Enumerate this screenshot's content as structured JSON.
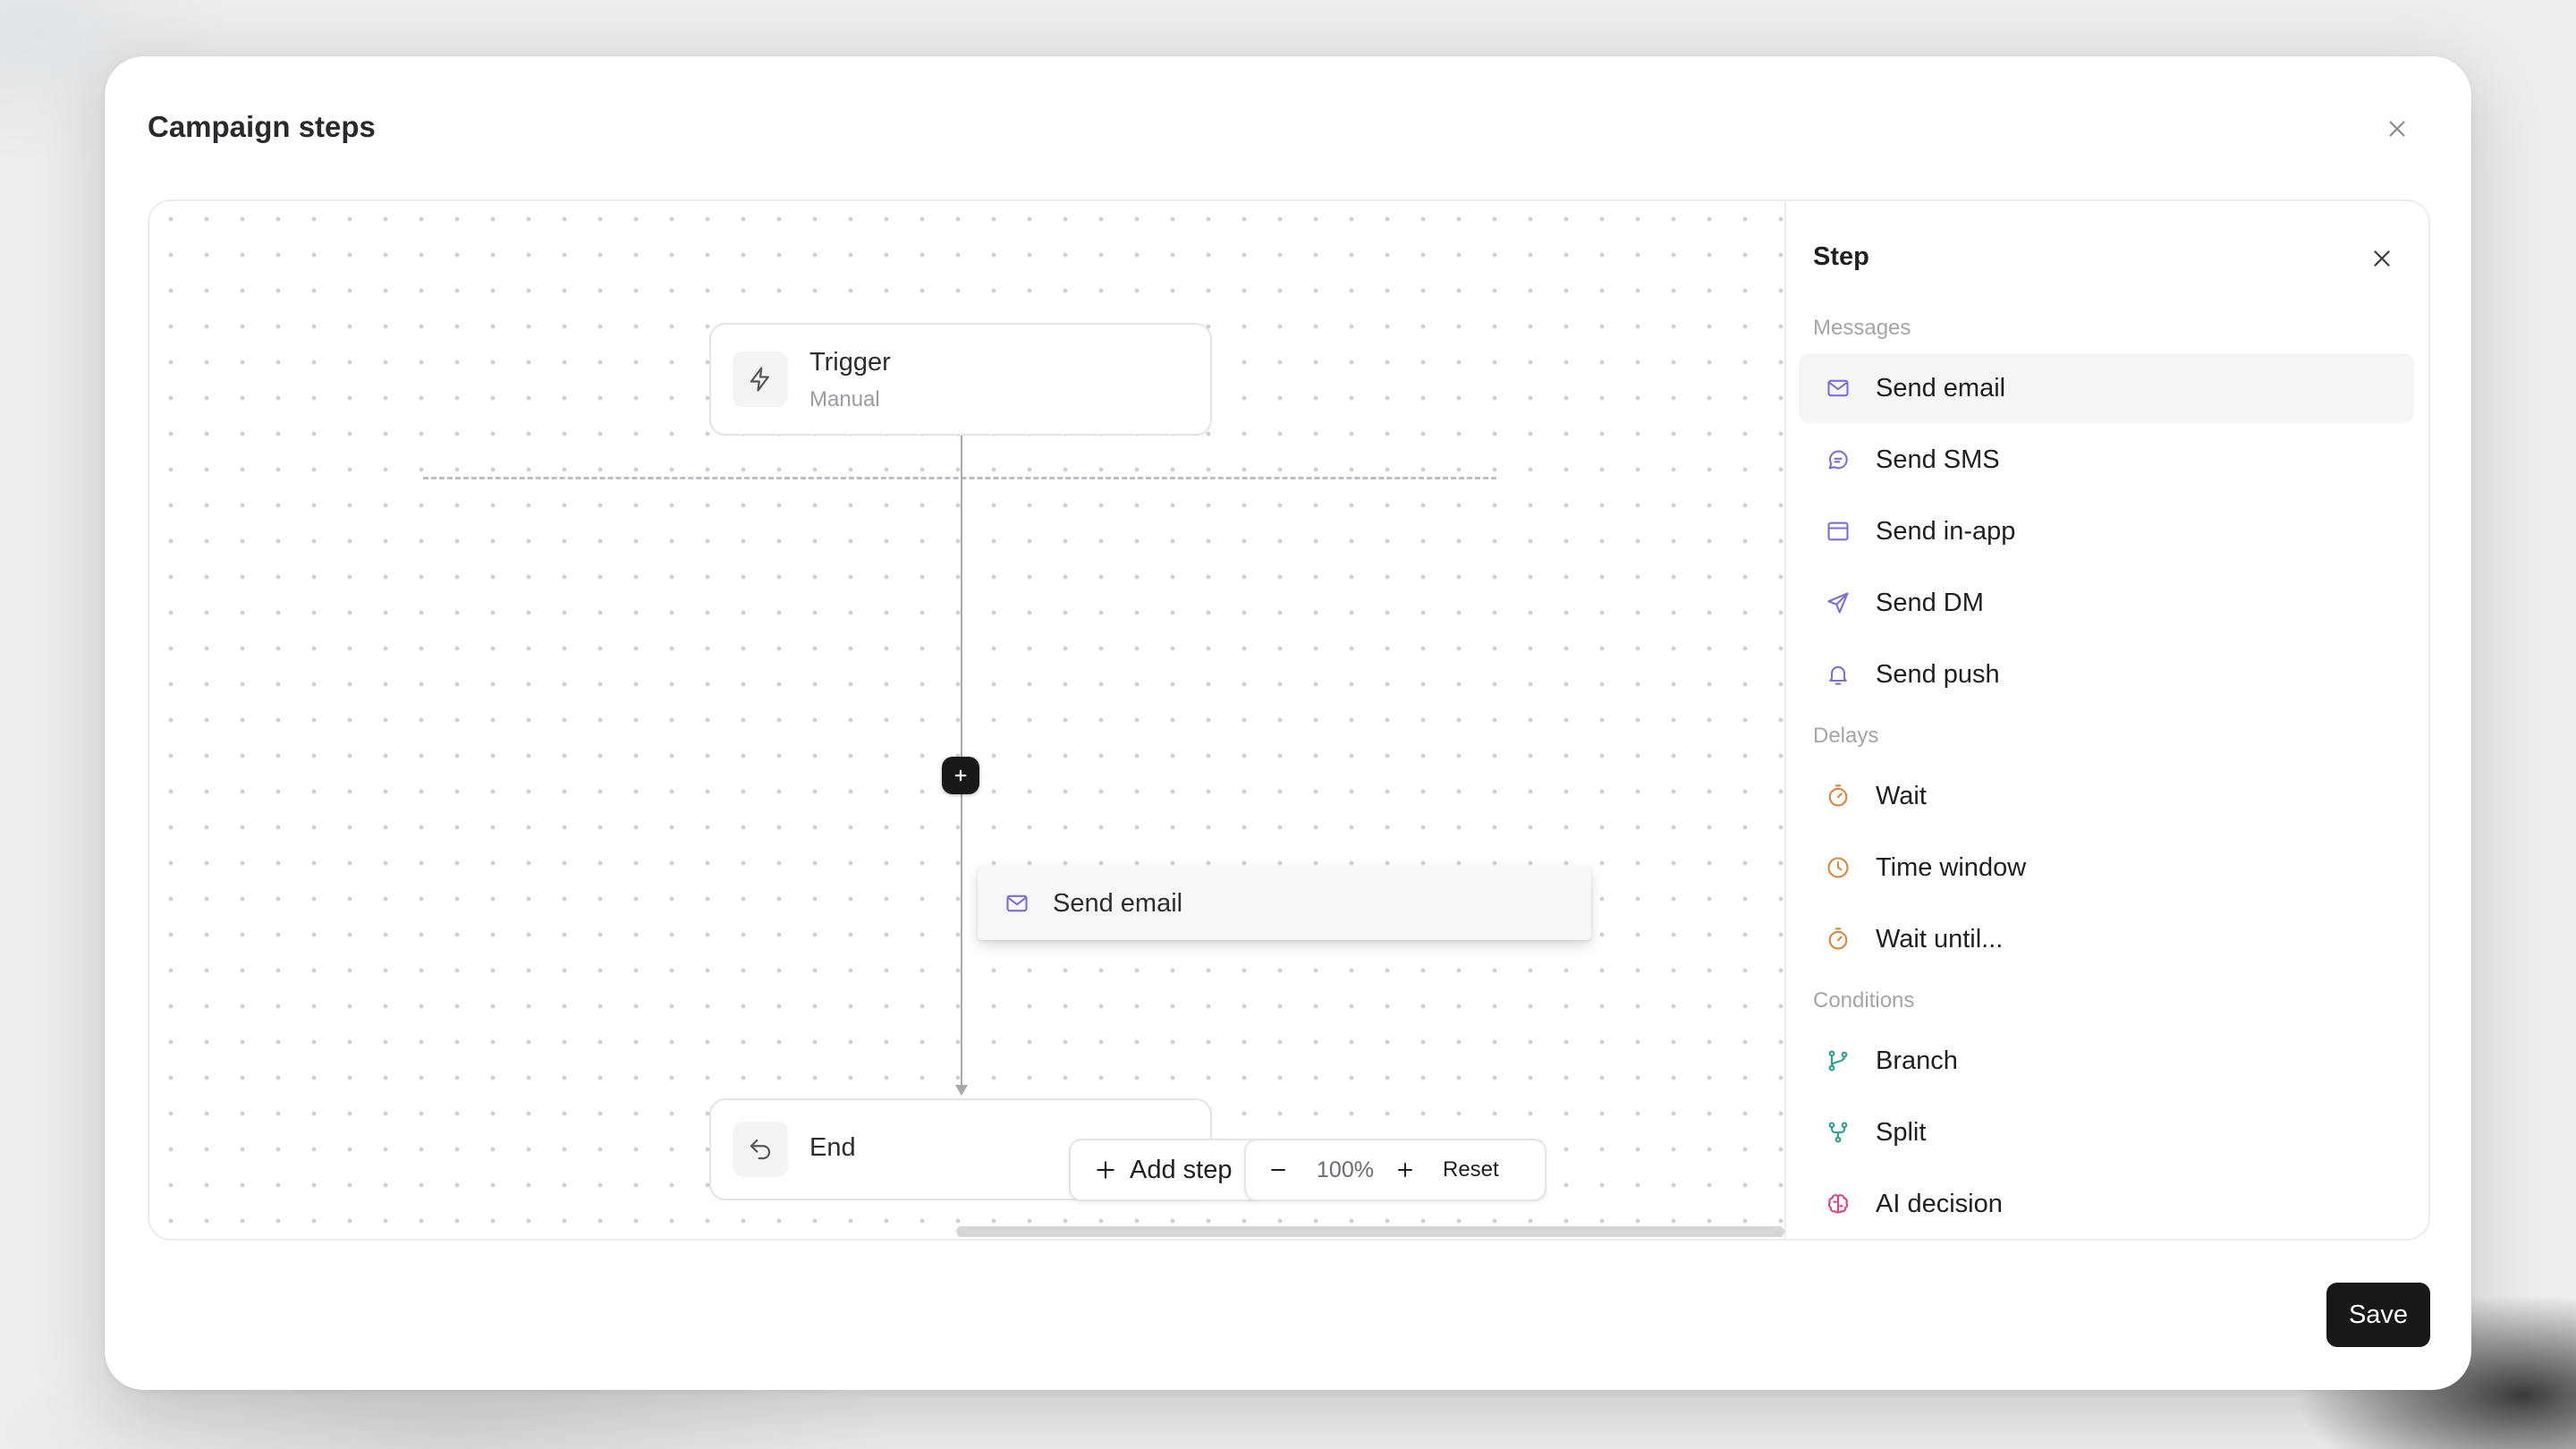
{
  "modal": {
    "title": "Campaign steps",
    "save_label": "Save"
  },
  "canvas": {
    "trigger_node": {
      "title": "Trigger",
      "subtitle": "Manual",
      "icon": "lightning-icon"
    },
    "end_node": {
      "title": "End",
      "icon": "undo-arrow-icon"
    },
    "drag_preview": {
      "label": "Send email",
      "icon": "mail-icon"
    },
    "toolbar": {
      "add_step_label": "Add step",
      "zoom_level": "100%",
      "reset_label": "Reset"
    }
  },
  "step_panel": {
    "title": "Step",
    "sections": [
      {
        "label": "Messages",
        "items": [
          {
            "label": "Send email",
            "icon": "mail-icon",
            "color": "#7c6fcf",
            "active": true
          },
          {
            "label": "Send SMS",
            "icon": "message-bubble-icon",
            "color": "#7c6fcf"
          },
          {
            "label": "Send in-app",
            "icon": "app-window-icon",
            "color": "#7c6fcf"
          },
          {
            "label": "Send DM",
            "icon": "send-icon",
            "color": "#7c6fcf"
          },
          {
            "label": "Send push",
            "icon": "bell-icon",
            "color": "#7c6fcf"
          }
        ]
      },
      {
        "label": "Delays",
        "items": [
          {
            "label": "Wait",
            "icon": "timer-icon",
            "color": "#d4873a"
          },
          {
            "label": "Time window",
            "icon": "clock-icon",
            "color": "#d4873a"
          },
          {
            "label": "Wait until...",
            "icon": "timer-icon",
            "color": "#d4873a"
          }
        ]
      },
      {
        "label": "Conditions",
        "items": [
          {
            "label": "Branch",
            "icon": "git-branch-icon",
            "color": "#2f9e8f"
          },
          {
            "label": "Split",
            "icon": "git-fork-icon",
            "color": "#2f9e8f"
          },
          {
            "label": "AI decision",
            "icon": "brain-icon",
            "color": "#d3488a"
          }
        ]
      }
    ]
  }
}
